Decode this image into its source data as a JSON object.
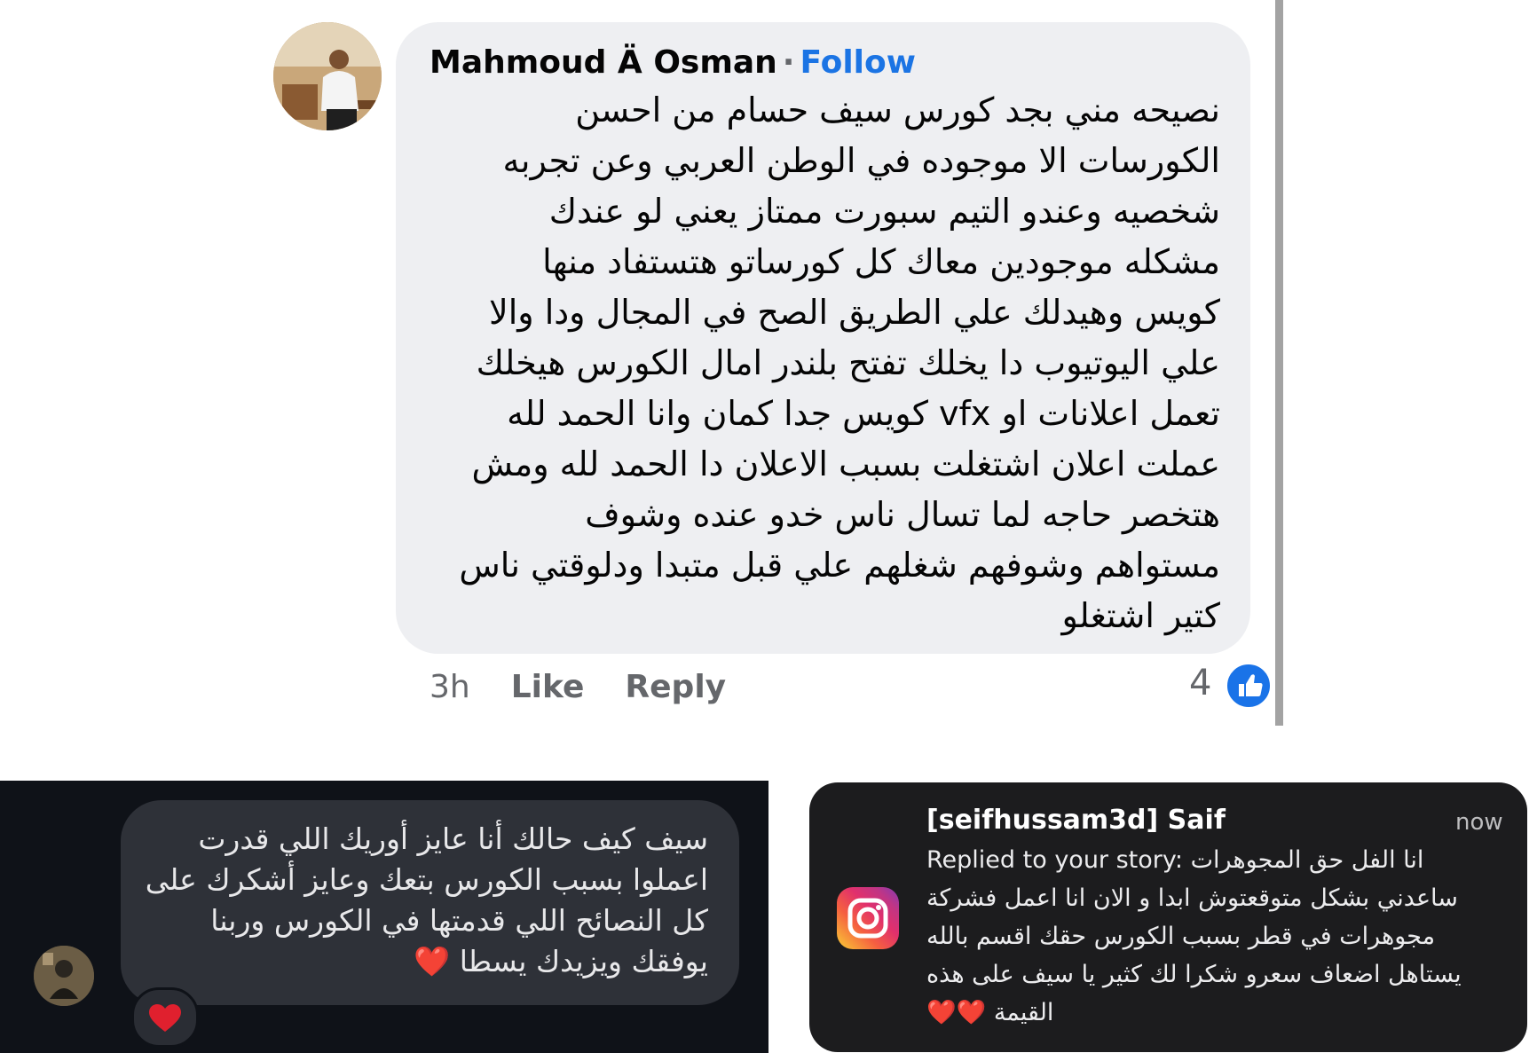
{
  "facebook_comment": {
    "author": "Mahmoud Ä Osman",
    "separator": "·",
    "follow_label": "Follow",
    "lines": [
      "نصيحه مني بجد كورس سيف حسام من احسن",
      "الكورسات الا موجوده في الوطن العربي وعن تجربه",
      "شخصيه وعندو التيم سبورت ممتاز يعني لو عندك",
      "مشكله موجودين معاك كل كورساتو هتستفاد منها",
      "كويس وهيدلك علي الطريق الصح في المجال ودا والا",
      "علي اليوتيوب دا يخلك تفتح بلندر امال الكورس هيخلك",
      "تعمل اعلانات او vfx كويس جدا كمان  وانا الحمد لله",
      "عملت اعلان اشتغلت بسبب الاعلان دا الحمد لله ومش",
      "هتخصر حاجه لما تسال ناس خدو عنده وشوف",
      "مستواهم وشوفهم شغلهم علي قبل متبدا  ودلوقتي ناس",
      "كتير اشتغلو"
    ],
    "time": "3h",
    "like_label": "Like",
    "reply_label": "Reply",
    "reaction_count": "4",
    "reaction_icon": "thumbs-up-icon"
  },
  "dark_message": {
    "lines": [
      "سيف كيف حالك أنا عايز أوريك اللي قدرت",
      "اعملوا بسبب الكورس بتعك وعايز أشكرك على",
      "كل النصائح اللي قدمتها في الكورس وربنا",
      "يوفقك ويزيدك يسطا ❤️"
    ],
    "reaction": "❤️"
  },
  "instagram_notification": {
    "title": "[seifhussam3d] Saif",
    "time": "now",
    "lines": [
      "Replied to your story: انا الفل حق المجوهرات",
      "ساعدني بشكل متوقعتوش ابدا و الان انا اعمل فشركة",
      "مجوهرات في قطر بسبب الكورس حقك اقسم بالله",
      "يستاهل اضعاف سعرو شكرا لك كثير يا سيف على هذه",
      "القيمة ❤️❤️"
    ]
  },
  "colors": {
    "facebook_link": "#1b74e4",
    "facebook_bubble": "#eeeff2",
    "dark_panel": "#0f1218",
    "instagram_card": "#1c1c1e"
  }
}
